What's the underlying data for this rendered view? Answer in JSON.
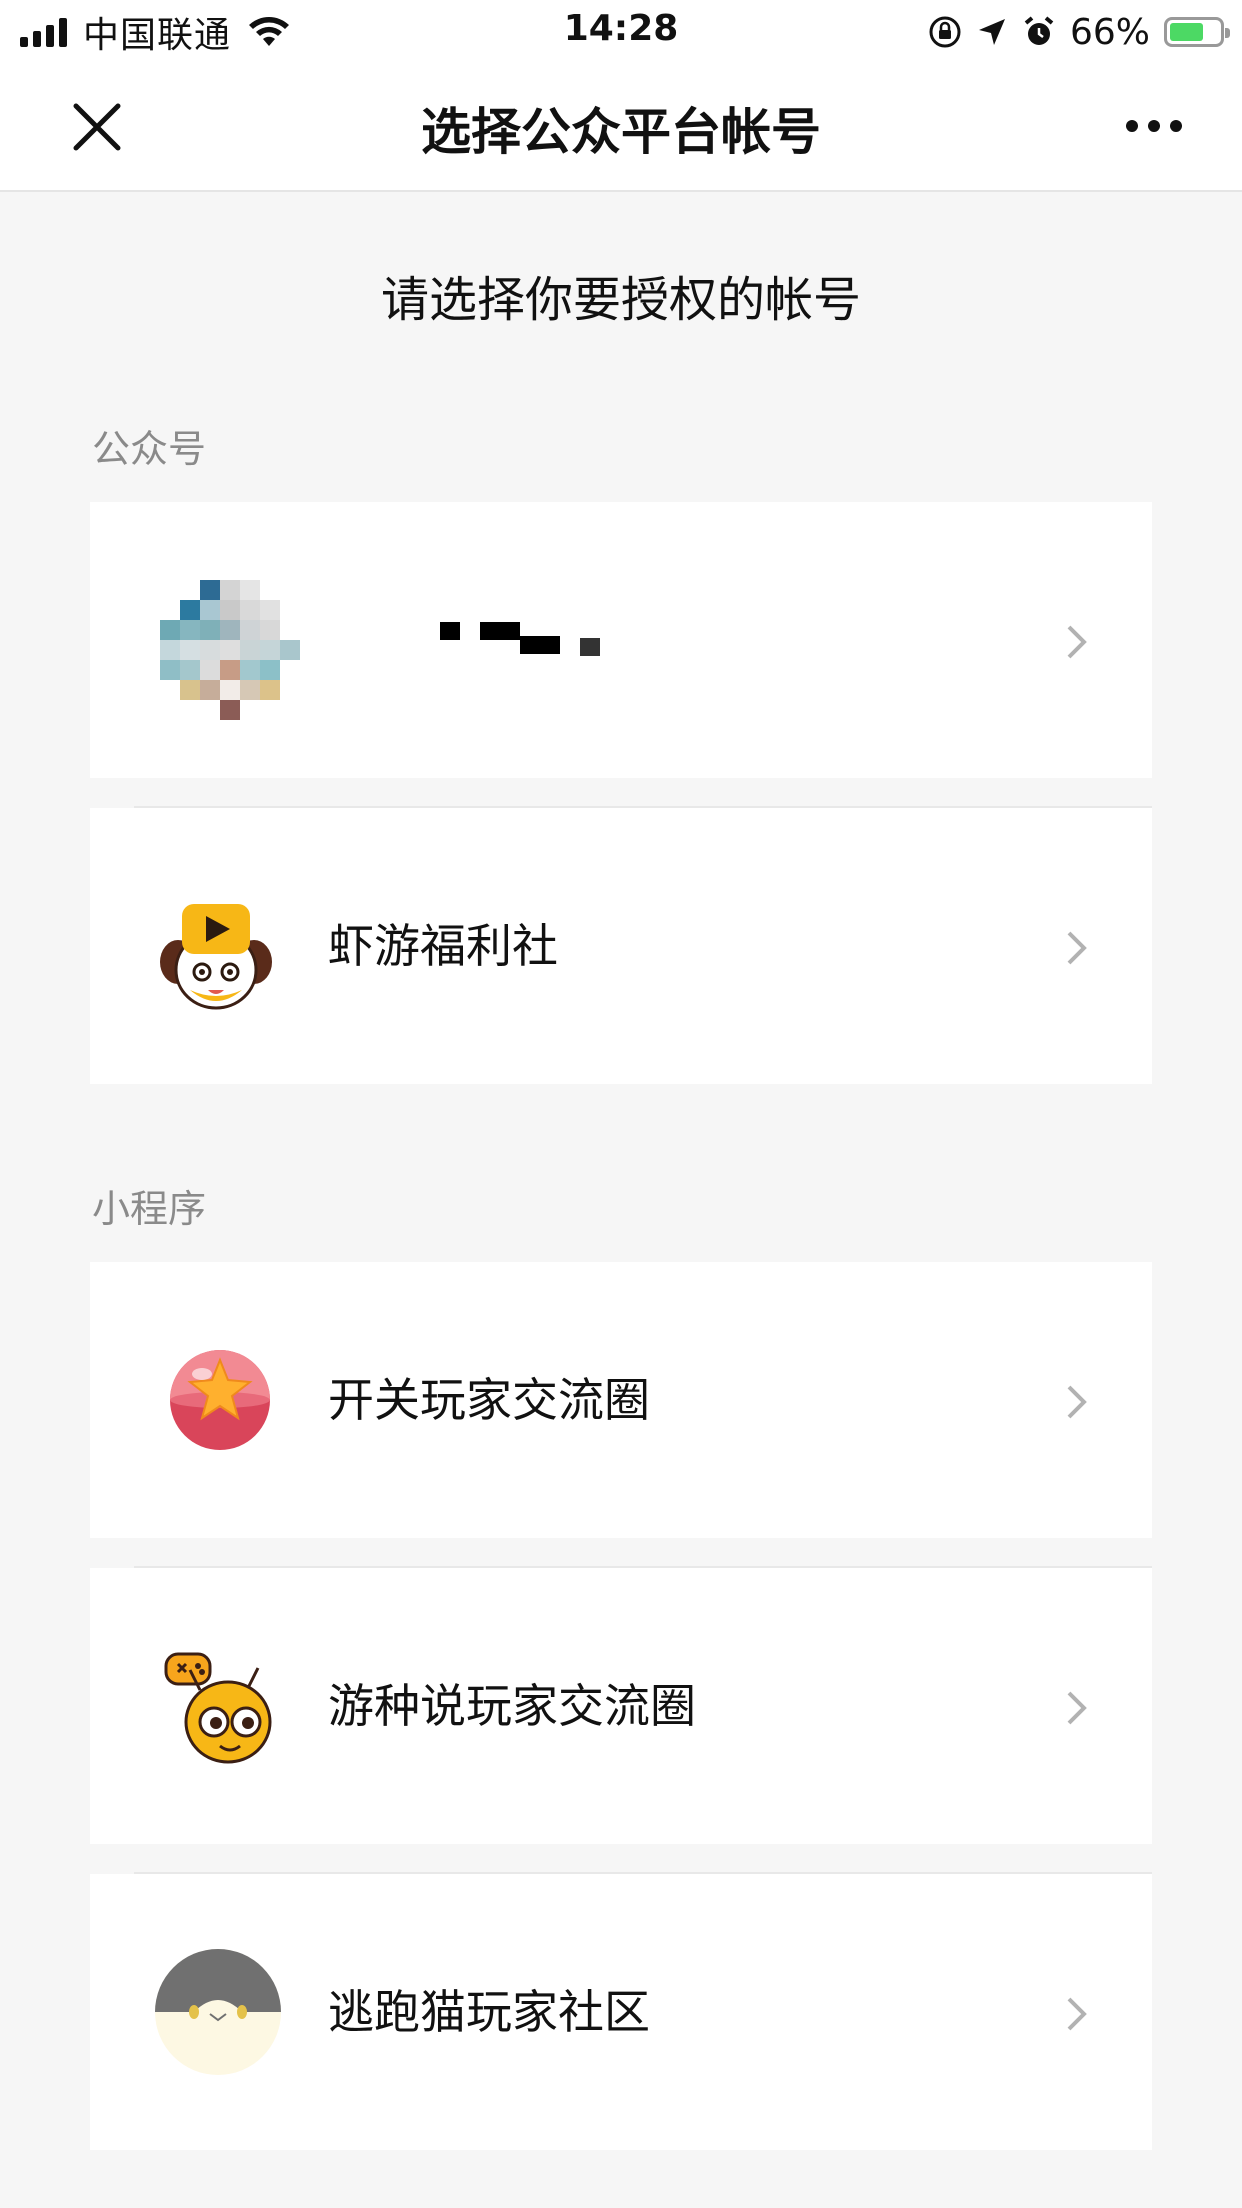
{
  "status_bar": {
    "carrier": "中国联通",
    "time": "14:28",
    "battery": "66%",
    "battery_level": 0.66
  },
  "nav": {
    "title": "选择公众平台帐号"
  },
  "prompt": "请选择你要授权的帐号",
  "sections": [
    {
      "title": "公众号",
      "items": [
        {
          "label": "",
          "avatar": "blurred-avatar-icon"
        },
        {
          "label": "虾游福利社",
          "avatar": "puppy-mascot-icon"
        }
      ]
    },
    {
      "title": "小程序",
      "items": [
        {
          "label": "开关玩家交流圈",
          "avatar": "star-ball-icon"
        },
        {
          "label": "游种说玩家交流圈",
          "avatar": "bee-gamepad-icon"
        },
        {
          "label": "逃跑猫玩家社区",
          "avatar": "cat-face-icon"
        }
      ]
    }
  ],
  "colors": {
    "background": "#f6f6f6",
    "card": "#ffffff",
    "section_title": "#8a8a8a",
    "battery_green": "#4cd964"
  }
}
